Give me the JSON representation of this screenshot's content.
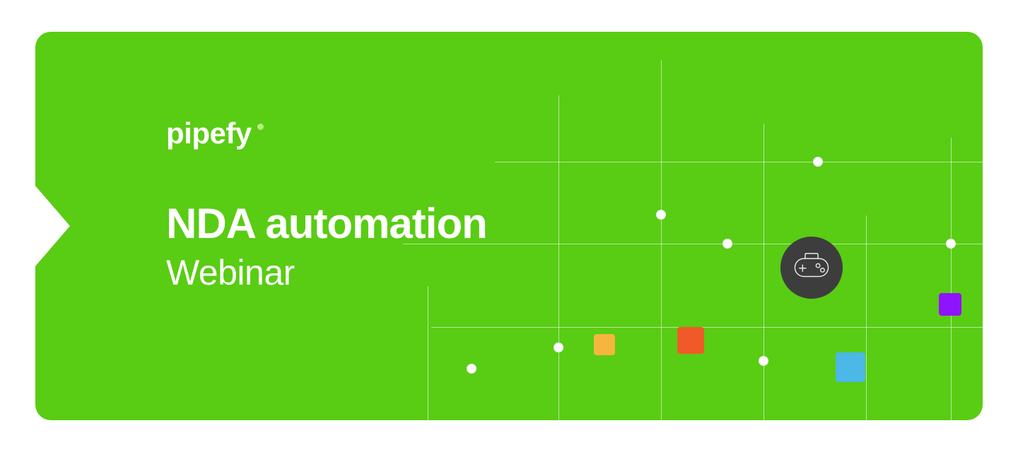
{
  "brand": {
    "name": "pipefy"
  },
  "hero": {
    "title": "NDA automation",
    "subtitle": "Webinar"
  },
  "icons": {
    "controller": "gamepad-icon"
  },
  "colors": {
    "background": "#59cc14",
    "accentSquares": {
      "yellow": "#f4b63f",
      "orange": "#f05a28",
      "blue": "#4bb8e8",
      "purple": "#9013fe"
    },
    "badge": "#3d3d3d"
  }
}
